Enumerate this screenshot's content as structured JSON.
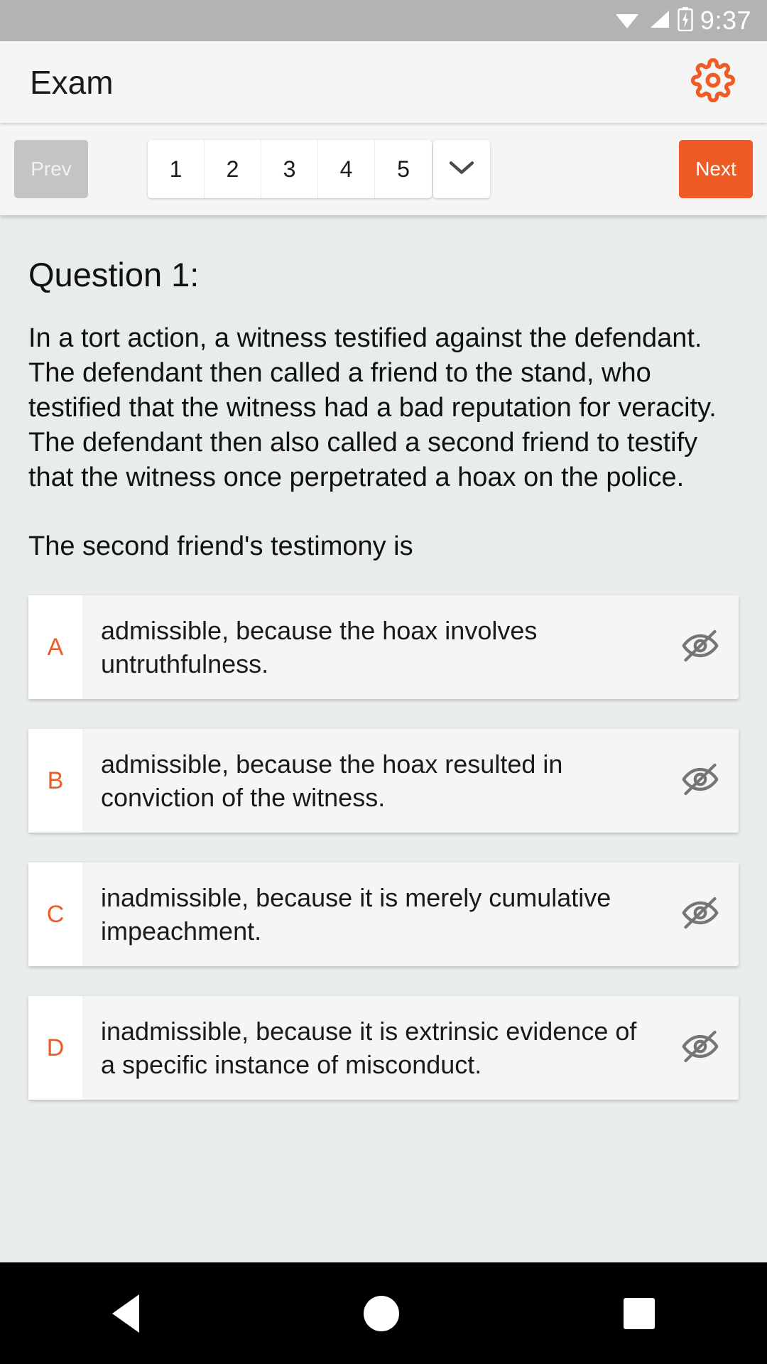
{
  "statusbar": {
    "time": "9:37",
    "icons": [
      "wifi-icon",
      "cellular-signal-icon",
      "battery-charging-icon"
    ]
  },
  "appbar": {
    "title": "Exam",
    "settings_icon": "gear-icon"
  },
  "pager": {
    "prev_label": "Prev",
    "next_label": "Next",
    "pages": [
      "1",
      "2",
      "3",
      "4",
      "5"
    ],
    "more_icon": "chevron-down-icon",
    "prev_disabled": true,
    "accent_color": "#EF5B25",
    "disabled_color": "#C4C4C4"
  },
  "question": {
    "heading": "Question 1:",
    "body": "In a tort action, a witness testified against the defendant. The defendant then called a friend to the stand, who testified that the witness had a bad reputation for veracity. The defendant then also called a second friend to testify that the witness once perpetrated a hoax on the police.",
    "prompt": "The second friend's testimony is"
  },
  "options": [
    {
      "letter": "A",
      "text": "admissible, because the hoax involves untruthfulness.",
      "action_icon": "eye-slash-icon"
    },
    {
      "letter": "B",
      "text": "admissible, because the hoax resulted in conviction of the witness.",
      "action_icon": "eye-slash-icon"
    },
    {
      "letter": "C",
      "text": "inadmissible, because it is merely cumulative impeachment.",
      "action_icon": "eye-slash-icon"
    },
    {
      "letter": "D",
      "text": "inadmissible, because it is extrinsic evidence of a specific instance of misconduct.",
      "action_icon": "eye-slash-icon"
    }
  ],
  "navbar": {
    "back_icon": "back-triangle-icon",
    "home_icon": "home-circle-icon",
    "recents_icon": "recents-square-icon"
  }
}
